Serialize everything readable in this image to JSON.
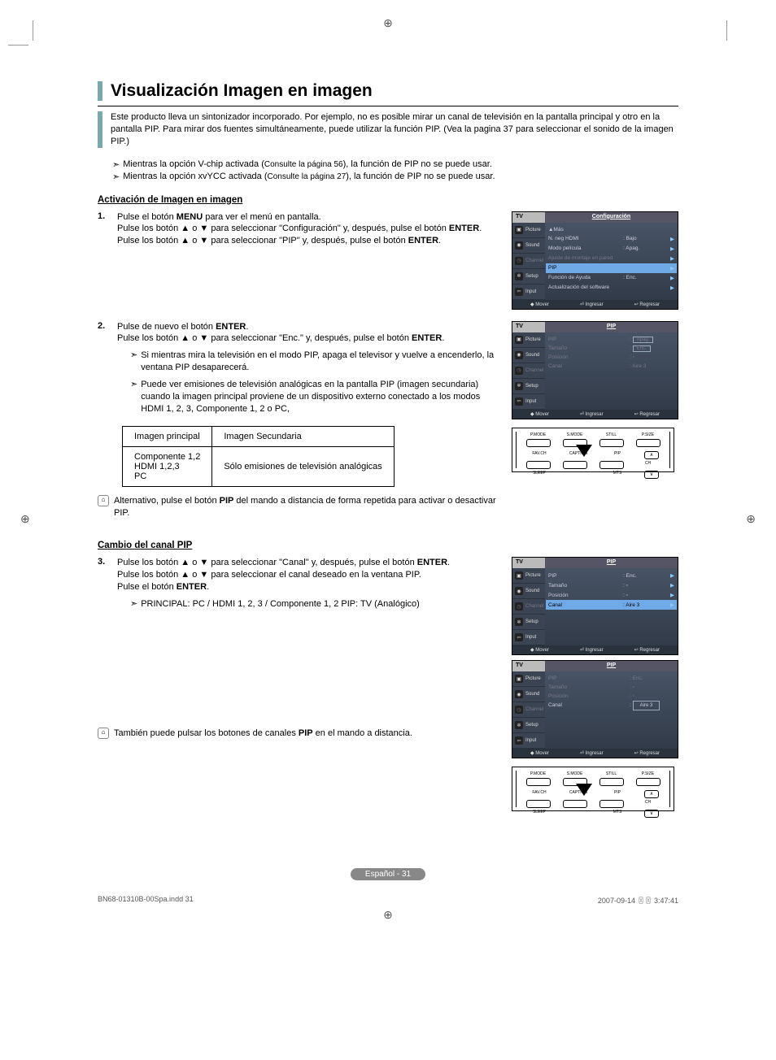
{
  "title": "Visualización Imagen en imagen",
  "intro": "Este producto lleva un sintonizador incorporado. Por ejemplo, no es posible mirar un canal de televisión en la pantalla principal y otro en la pantalla PIP. Para mirar dos fuentes simultáneamente, puede utilizar la función PIP. (Vea la pagina 37 para seleccionar el sonido de la imagen PIP.)",
  "notes": {
    "n1a": "Mientras la opción V-chip activada (",
    "n1b": "Consulte la página 56",
    "n1c": "), la función de PIP no se puede usar.",
    "n2a": "Mientras la opción xvYCC activada (",
    "n2b": "Consulte la página 27",
    "n2c": "), la función de PIP no se puede usar."
  },
  "sec1_head": "Activación de Imagen en imagen",
  "step1": {
    "num": "1.",
    "l1a": "Pulse el botón ",
    "l1b": "MENU",
    "l1c": " para ver el menú en pantalla.",
    "l2": "Pulse los botón ▲ o ▼ para seleccionar \"Configuración\" y, después, pulse el botón ",
    "l2b": "ENTER",
    "l2c": ".",
    "l3": "Pulse los botón ▲ o ▼ para seleccionar \"PIP\" y, después, pulse el botón ",
    "l3b": "ENTER",
    "l3c": "."
  },
  "step2": {
    "num": "2.",
    "l1a": "Pulse de nuevo el botón ",
    "l1b": "ENTER",
    "l1c": ".",
    "l2": "Pulse los botón ▲ o ▼ para seleccionar \"Enc.\" y, después, pulse el botón ",
    "l2b": "ENTER",
    "l2c": ".",
    "s1": "Si mientras mira la televisión en el modo PIP, apaga el televisor y vuelve a encenderlo, la ventana PIP desaparecerá.",
    "s2": "Puede ver emisiones de televisión analógicas en la pantalla PIP (imagen secundaria) cuando la imagen principal proviene de un dispositivo externo conectado a los modos HDMI 1, 2, 3, Componente 1, 2 o PC,"
  },
  "table": {
    "h1": "Imagen principal",
    "h2": "Imagen Secundaria",
    "c1": "Componente 1,2\nHDMI 1,2,3\nPC",
    "c2": "Sólo emisiones de televisión analógicas"
  },
  "tip1a": "Alternativo, pulse el botón ",
  "tip1b": "PIP",
  "tip1c": " del mando a distancia de forma repetida para activar o desactivar PIP.",
  "sec2_head": "Cambio del canal PIP",
  "step3": {
    "num": "3.",
    "l1": "Pulse los botón ▲ o ▼ para seleccionar \"Canal\" y, después, pulse el botón ",
    "l1b": "ENTER",
    "l1c": ".",
    "l2": "Pulse los botón ▲ o ▼ para seleccionar el canal deseado en la ventana PIP.",
    "l3a": "Pulse el botón ",
    "l3b": "ENTER",
    "l3c": ".",
    "s1": "PRINCIPAL: PC / HDMI 1, 2, 3 / Componente 1, 2\nPIP: TV (Analógico)"
  },
  "tip2a": "También puede pulsar los botones de canales ",
  "tip2b": "PIP",
  "tip2c": " en el mando a distancia.",
  "osd": {
    "tv": "TV",
    "sidebar": [
      "Picture",
      "Sound",
      "Channel",
      "Setup",
      "Input"
    ],
    "titleA": "Configuración",
    "menuA": {
      "more": "▲Más",
      "r1k": "N. neg HDMI",
      "r1v": ": Bajo",
      "r2k": "Modo película",
      "r2v": ": Apag.",
      "r3k": "Ajuste de montaje en pared",
      "r4k": "PIP",
      "r5k": "Función de Ayuda",
      "r5v": ": Enc.",
      "r6k": "Actualización del software"
    },
    "titleB": "PIP",
    "menuB": {
      "r1k": "PIP",
      "r1v": "Apag.",
      "r1v2": "Enc.",
      "r2k": "Tamaño",
      "r2v": "▫",
      "r3k": "Posición",
      "r3v": "▫",
      "r4k": "Canal",
      "r4v": ": Aire 3"
    },
    "menuC": {
      "r1k": "PIP",
      "r1v": ": Enc.",
      "r2k": "Tamaño",
      "r2v": "▫",
      "r3k": "Posición",
      "r3v": "▫",
      "r4k": "Canal",
      "r4v": ": Aire 3"
    },
    "foot": {
      "mover": "◆ Mover",
      "ing": "⏎ Ingresar",
      "reg": "↩ Regresar"
    }
  },
  "remote": {
    "top": [
      "P.MODE",
      "S.MODE",
      "STILL",
      "P.SIZE"
    ],
    "mid": [
      "FAV.CH",
      "CAPTION",
      "PIP"
    ],
    "bot": [
      "SLEEP",
      "",
      "MTS"
    ],
    "ch": "CH",
    "up": "∧",
    "dn": "∨"
  },
  "footer": "Español - 31",
  "imprint_left": "BN68-01310B-00Spa.indd   31",
  "imprint_right": "2007-09-14   〿〿 3:47:41"
}
